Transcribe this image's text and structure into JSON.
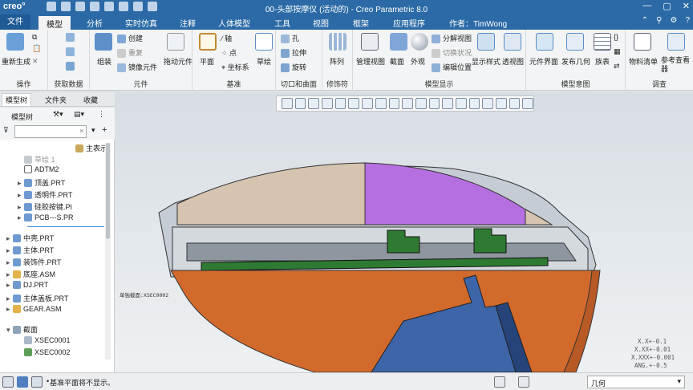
{
  "app": {
    "logo": "creo°",
    "window_title": "00-头部按摩仪 (活动的) - Creo Parametric 8.0",
    "author": "作者：TimWong"
  },
  "menu": {
    "file": "文件",
    "tabs": [
      "模型",
      "分析",
      "实时仿真",
      "注释",
      "人体模型",
      "工具",
      "视图",
      "框架",
      "应用程序"
    ]
  },
  "ribbon": {
    "operations": {
      "regenerate": "重新生成",
      "label": "操作"
    },
    "get_data": {
      "label": "获取数据"
    },
    "component": {
      "assemble": "组装",
      "create": "创建",
      "repeat": "重复",
      "mirror": "镜像元件",
      "drag": "拖动元件",
      "label": "元件"
    },
    "datum": {
      "plane": "平面",
      "axis": "轴",
      "point": "点",
      "csys": "坐标系",
      "sketch": "草绘",
      "label": "基准"
    },
    "cut_surface": {
      "hole": "孔",
      "extrude": "拉伸",
      "revolve": "旋转",
      "label": "切口和曲面"
    },
    "modifier": {
      "pattern": "阵列",
      "label": "修饰符"
    },
    "model_display": {
      "manage_views": "管理视图",
      "section": "截面",
      "appearance": "外观",
      "explode": "分解视图",
      "toggle": "切换状况",
      "edit_pos": "编辑位置",
      "display_style": "显示样式",
      "perspective": "透视图",
      "label": "模型显示"
    },
    "model_intent": {
      "comp_interface": "元件界面",
      "publish_geom": "发布几何",
      "table": "族表",
      "label": "模型意图"
    },
    "investigate": {
      "bom": "物料清单",
      "ref_viewer": "参考查看器",
      "label": "调查"
    }
  },
  "left_tabs": [
    "模型树",
    "文件夹",
    "收藏"
  ],
  "tree": {
    "header": "模型树",
    "show": "主表示",
    "items": [
      {
        "label": "草绘 1",
        "icon": "sketch-icon",
        "expand": false,
        "dim": true
      },
      {
        "label": "ADTM2",
        "icon": "datum-plane-icon",
        "expand": false
      },
      {
        "label": "顶盖.PRT",
        "icon": "part-icon",
        "expand": true
      },
      {
        "label": "透明件.PRT",
        "icon": "part-icon",
        "expand": true
      },
      {
        "label": "硅胶按键.PI",
        "icon": "part-icon",
        "expand": true
      },
      {
        "label": "PCB---S.PR",
        "icon": "part-icon",
        "expand": true
      },
      {
        "label": "中壳.PRT",
        "icon": "part-icon",
        "expand": true
      },
      {
        "label": "主体.PRT",
        "icon": "part-icon",
        "expand": true
      },
      {
        "label": "装饰件.PRT",
        "icon": "part-icon",
        "expand": true
      },
      {
        "label": "底座.ASM",
        "icon": "assembly-icon",
        "expand": true
      },
      {
        "label": "DJ.PRT",
        "icon": "part-icon",
        "expand": true
      },
      {
        "label": "主体盖板.PRT",
        "icon": "part-icon",
        "expand": true
      },
      {
        "label": "GEAR.ASM",
        "icon": "assembly-icon",
        "expand": true
      },
      {
        "label": "截面",
        "icon": "section-folder-icon",
        "expand": true
      },
      {
        "label": "XSEC0001",
        "icon": "section-icon",
        "expand": false
      },
      {
        "label": "XSEC0002",
        "icon": "section-icon",
        "expand": false
      }
    ]
  },
  "viewport": {
    "section_label": "单独截面:XSEC0002",
    "tolerances": [
      "X.X+-0.1",
      "X.XX+-0.01",
      "X.XXX+-0.001",
      "ANG.+-0.5"
    ]
  },
  "status": {
    "message": "基准平面将不显示。",
    "selection_filter": "几何"
  },
  "colors": {
    "accent": "#2b6aa6",
    "orange": "#d26a2c",
    "blue": "#3d65a8",
    "green": "#2f7a33",
    "purple": "#b66fe0",
    "tan": "#d6c4b0"
  }
}
